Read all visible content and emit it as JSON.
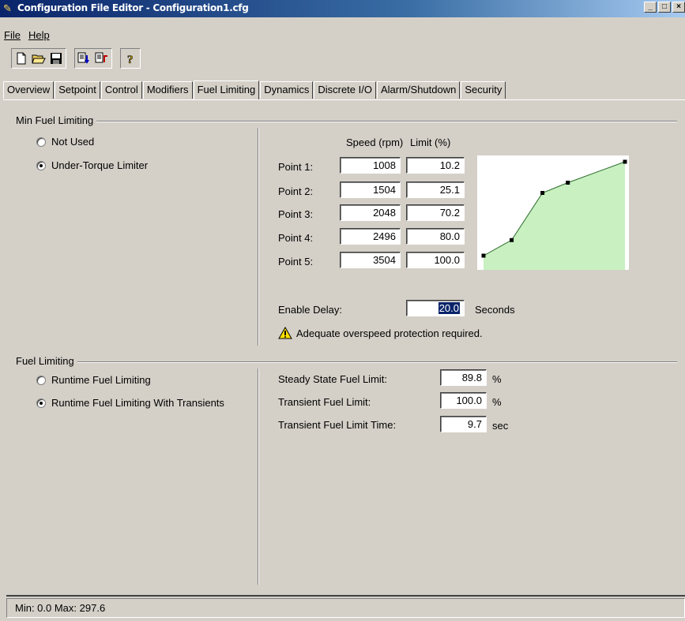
{
  "window": {
    "title": "Configuration File Editor - Configuration1.cfg",
    "app_icon": "tools-icon"
  },
  "menu": {
    "file": "File",
    "help": "Help"
  },
  "toolbar": {
    "buttons": [
      "new-file-icon",
      "open-folder-icon",
      "save-disk-icon",
      "import-icon",
      "export-icon",
      "help-icon"
    ]
  },
  "tabs": [
    "Overview",
    "Setpoint",
    "Control",
    "Modifiers",
    "Fuel Limiting",
    "Dynamics",
    "Discrete I/O",
    "Alarm/Shutdown",
    "Security"
  ],
  "active_tab": "Fuel Limiting",
  "min_fuel": {
    "title": "Min Fuel Limiting",
    "options": [
      {
        "label": "Not Used",
        "checked": false
      },
      {
        "label": "Under-Torque Limiter",
        "checked": true
      }
    ],
    "col_speed": "Speed (rpm)",
    "col_limit": "Limit (%)",
    "points": [
      {
        "label": "Point 1:",
        "speed": "1008",
        "limit": "10.2"
      },
      {
        "label": "Point 2:",
        "speed": "1504",
        "limit": "25.1"
      },
      {
        "label": "Point 3:",
        "speed": "2048",
        "limit": "70.2"
      },
      {
        "label": "Point 4:",
        "speed": "2496",
        "limit": "80.0"
      },
      {
        "label": "Point 5:",
        "speed": "3504",
        "limit": "100.0"
      }
    ],
    "enable_delay_label": "Enable Delay:",
    "enable_delay_value": "20.0",
    "enable_delay_unit": "Seconds",
    "warning": "Adequate overspeed protection required."
  },
  "fuel_limiting": {
    "title": "Fuel Limiting",
    "options": [
      {
        "label": "Runtime Fuel Limiting",
        "checked": false
      },
      {
        "label": "Runtime Fuel Limiting With Transients",
        "checked": true
      }
    ],
    "steady_label": "Steady State Fuel Limit:",
    "steady_value": "89.8",
    "steady_unit": "%",
    "transient_label": "Transient Fuel Limit:",
    "transient_value": "100.0",
    "transient_unit": "%",
    "transient_time_label": "Transient Fuel Limit Time:",
    "transient_time_value": "9.7",
    "transient_time_unit": "sec"
  },
  "chart_data": {
    "type": "area",
    "x": [
      1008,
      1504,
      2048,
      2496,
      3504
    ],
    "values": [
      10.2,
      25.1,
      70.2,
      80.0,
      100.0
    ],
    "fill_color": "#c8f0c0",
    "line_color": "#2a6a2a"
  },
  "status": "Min: 0.0 Max: 297.6"
}
